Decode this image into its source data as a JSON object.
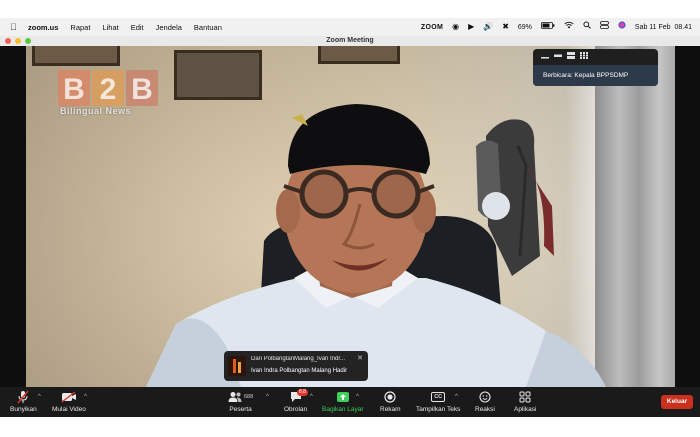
{
  "menubar": {
    "app": "zoom.us",
    "items": [
      "Rapat",
      "Lihat",
      "Edit",
      "Jendela",
      "Bantuan"
    ],
    "status_app": "ZOOM",
    "battery": "69%",
    "datetime": "Sab 11 Feb  08.41"
  },
  "window": {
    "title": "Zoom Meeting"
  },
  "watermark": {
    "brand": "B2B",
    "tagline": "Bilingual News"
  },
  "speaker": {
    "label": "Berbicara: Kepala BPPSDMP"
  },
  "chat_notification": {
    "from": "Dari PolbangtanMalang_Ivan Indr...",
    "message": "Ivan Indra Polbangtan Malang Hadir"
  },
  "toolbar": {
    "unmute": "Bunyikan",
    "start_video": "Mulai Video",
    "participants": "Peserta",
    "participants_count": "688",
    "chat": "Obrolan",
    "chat_badge": "8.8",
    "share_screen": "Bagikan Layar",
    "record": "Rekam",
    "captions": "Tampilkan Teks",
    "captions_icon_text": "CC",
    "reactions": "Reaksi",
    "apps": "Aplikasi",
    "leave": "Keluar"
  },
  "colors": {
    "leave_red": "#c9301f",
    "share_green": "#3ecf5b",
    "speaker_label_bg": "#2c3a4a",
    "toolbar_bg": "#1a1a1a"
  }
}
